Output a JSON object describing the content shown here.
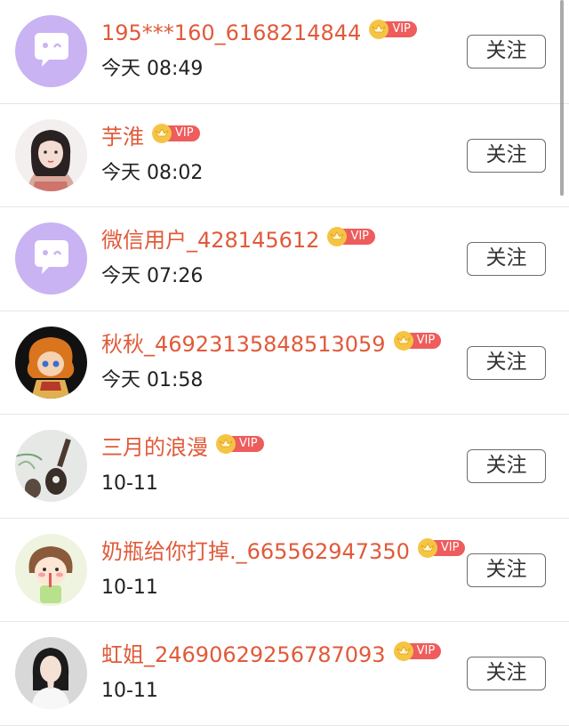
{
  "follow_label": "关注",
  "vip_label": "VIP",
  "colors": {
    "name": "#e05a3a",
    "vip_badge": "#ef5c5c",
    "crown": "#f6c445",
    "avatar_default": "#c9b3f2"
  },
  "users": [
    {
      "name": "195***160_6168214844",
      "time": "今天 08:49",
      "avatar": "default-wechat-avatar"
    },
    {
      "name": "芋淮",
      "time": "今天 08:02",
      "avatar": "girl-photo-avatar"
    },
    {
      "name": "微信用户_428145612",
      "time": "今天 07:26",
      "avatar": "default-wechat-avatar"
    },
    {
      "name": "秋秋_46923135848513059",
      "time": "今天 01:58",
      "avatar": "cartoon-character-avatar"
    },
    {
      "name": "三月的浪漫",
      "time": "10-11",
      "avatar": "guitar-illustration-avatar"
    },
    {
      "name": "奶瓶给你打掉._665562947350",
      "time": "10-11",
      "avatar": "cartoon-girl-drink-avatar"
    },
    {
      "name": "虹姐_24690629256787093",
      "time": "10-11",
      "avatar": "woman-photo-avatar"
    }
  ]
}
